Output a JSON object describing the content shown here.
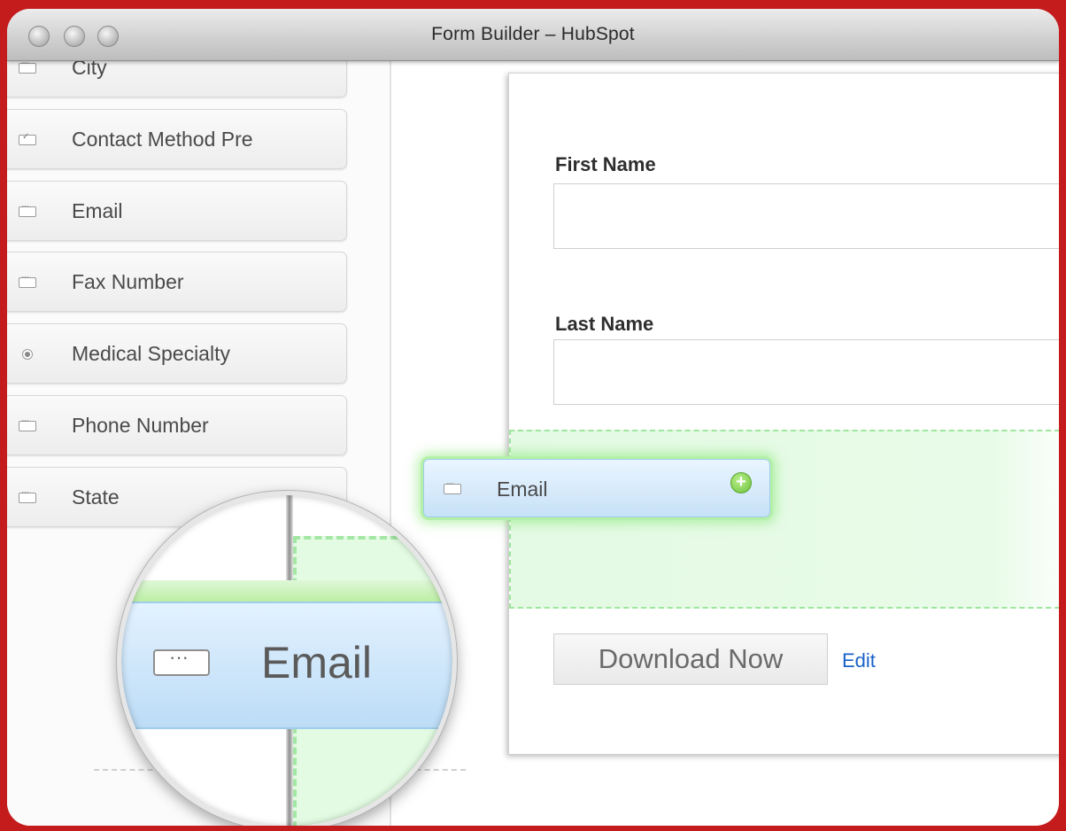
{
  "window": {
    "title": "Form Builder – HubSpot"
  },
  "sidebar": {
    "items": [
      {
        "label": "City",
        "icon": "text-field-icon"
      },
      {
        "label": "Contact Method Pre",
        "icon": "checkbox-icon"
      },
      {
        "label": "Email",
        "icon": "text-field-icon"
      },
      {
        "label": "Fax Number",
        "icon": "text-field-icon"
      },
      {
        "label": "Medical Specialty",
        "icon": "radio-icon"
      },
      {
        "label": "Phone Number",
        "icon": "text-field-icon"
      },
      {
        "label": "State",
        "icon": "text-field-icon"
      }
    ]
  },
  "form": {
    "fields": [
      {
        "label": "First Name",
        "value": ""
      },
      {
        "label": "Last Name",
        "value": ""
      }
    ],
    "submit_label": "Download Now",
    "edit_label": "Edit"
  },
  "drag": {
    "label": "Email",
    "badge": "+"
  },
  "magnifier": {
    "label": "Email"
  },
  "colors": {
    "frame": "#c41c1c",
    "drop_zone": "#e4fae4",
    "drag_item": "#c7e1f7",
    "edit_link": "#1a62c8"
  }
}
